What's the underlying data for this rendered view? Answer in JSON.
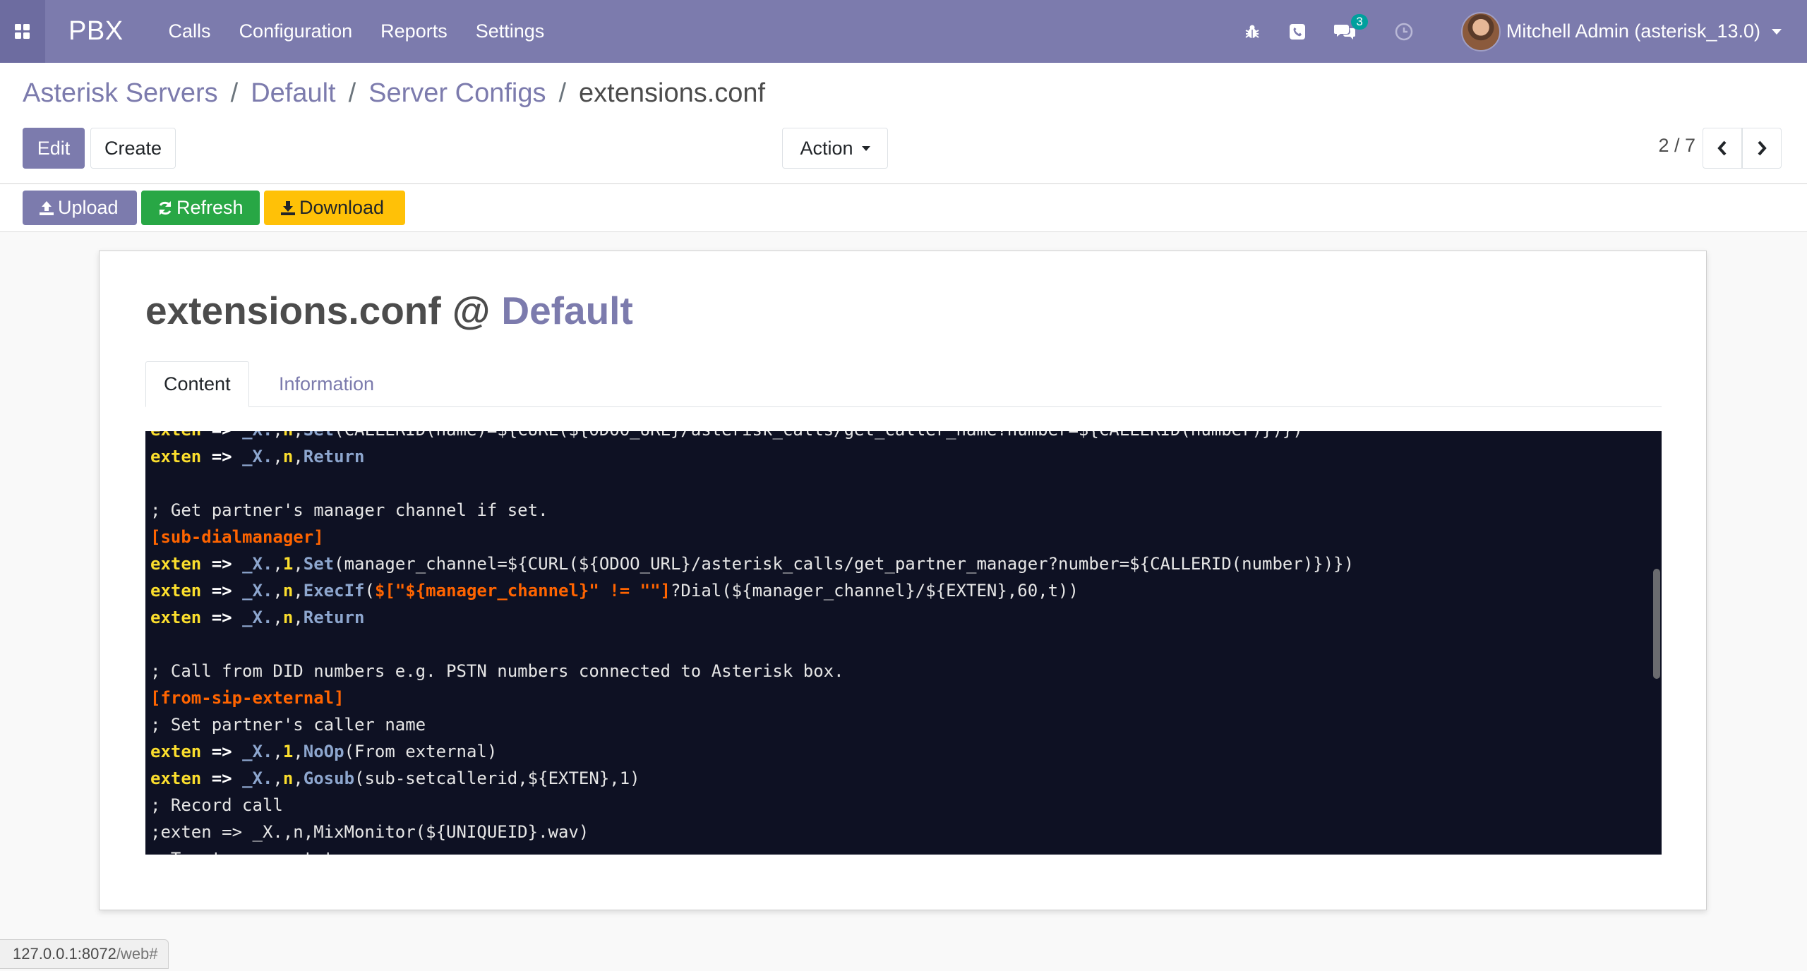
{
  "navbar": {
    "brand": "PBX",
    "menu": [
      "Calls",
      "Configuration",
      "Reports",
      "Settings"
    ],
    "messages_count": "3",
    "user_name": "Mitchell Admin (asterisk_13.0)"
  },
  "breadcrumb": {
    "items": [
      "Asterisk Servers",
      "Default",
      "Server Configs"
    ],
    "separator": "/",
    "current": "extensions.conf"
  },
  "control_panel": {
    "edit_label": "Edit",
    "create_label": "Create",
    "action_label": "Action",
    "pager": "2 / 7"
  },
  "statusbar": {
    "upload_label": "Upload",
    "refresh_label": "Refresh",
    "download_label": "Download"
  },
  "form": {
    "title_name": "extensions.conf",
    "title_at": "@",
    "title_server": "Default",
    "tabs": [
      "Content",
      "Information"
    ]
  },
  "editor": {
    "lines": [
      "exten => _X.,n,Set(CALLERID(name)=${CURL(${ODOO_URL}/asterisk_calls/get_caller_name?number=${CALLERID(number)})})",
      "exten => _X.,n,Return",
      "",
      "; Get partner's manager channel if set.",
      "[sub-dialmanager]",
      "exten => _X.,1,Set(manager_channel=${CURL(${ODOO_URL}/asterisk_calls/get_partner_manager?number=${CALLERID(number)})})",
      "exten => _X.,n,ExecIf($[\"${manager_channel}\" != \"\"]?Dial(${manager_channel}/${EXTEN},60,t))",
      "exten => _X.,n,Return",
      "",
      "; Call from DID numbers e.g. PSTN numbers connected to Asterisk box.",
      "[from-sip-external]",
      "; Set partner's caller name",
      "exten => _X.,1,NoOp(From external)",
      "exten => _X.,n,Gosub(sub-setcallerid,${EXTEN},1)",
      "; Record call",
      ";exten => _X.,n,MixMonitor(${UNIQUEID}.wav)",
      "; Try to connect to manager"
    ]
  },
  "status_url": {
    "host": "127.0.0.1:8072",
    "path": "/web#"
  },
  "colors": {
    "brand": "#7c7bad",
    "upload": "#7c7bad",
    "refresh": "#28a745",
    "download": "#ffc107",
    "editor_bg": "#0e1123"
  }
}
